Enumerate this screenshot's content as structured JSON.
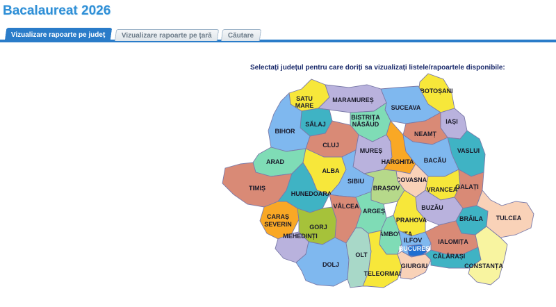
{
  "page": {
    "title": "Bacalaureat 2026"
  },
  "tabs": [
    {
      "label": "Vizualizare rapoarte pe județ",
      "active": true
    },
    {
      "label": "Vizualizare rapoarte pe țară",
      "active": false
    },
    {
      "label": "Căutare",
      "active": false
    }
  ],
  "map": {
    "instruction": "Selectați județul pentru care doriți sa vizualizați listele/rapoartele disponibile:",
    "counties": {
      "satu_mare": {
        "line1": "SATU",
        "line2": "MARE",
        "color": "#f7e73a"
      },
      "maramures": {
        "label": "MARAMUREȘ",
        "color": "#b9b2dd"
      },
      "botosani": {
        "label": "BOTOȘANI",
        "color": "#f7e73a"
      },
      "suceava": {
        "label": "SUCEAVA",
        "color": "#7fb8ef"
      },
      "bistrita": {
        "line1": "BISTRIȚA",
        "line2": "NĂSĂUD",
        "color": "#7fdcb6"
      },
      "salaj": {
        "label": "SĂLAJ",
        "color": "#3fb3c4"
      },
      "bihor": {
        "label": "BIHOR",
        "color": "#7fb8ef"
      },
      "iasi": {
        "label": "IAȘI",
        "color": "#b9b2dd"
      },
      "neamt": {
        "label": "NEAMȚ",
        "color": "#d98a76"
      },
      "cluj": {
        "label": "CLUJ",
        "color": "#d98a76"
      },
      "mures": {
        "label": "MUREȘ",
        "color": "#b9b2dd"
      },
      "harghita": {
        "label": "HARGHITA",
        "color": "#f9a825"
      },
      "vaslui": {
        "label": "VASLUI",
        "color": "#3fb3c4"
      },
      "bacau": {
        "label": "BACĂU",
        "color": "#7fb8ef"
      },
      "arad": {
        "label": "ARAD",
        "color": "#7fdcb6"
      },
      "alba": {
        "label": "ALBA",
        "color": "#f7e73a"
      },
      "sibiu": {
        "label": "SIBIU",
        "color": "#7fb8ef"
      },
      "covasna": {
        "label": "COVASNA",
        "color": "#f9d2b8"
      },
      "vrancea": {
        "label": "VRANCEA",
        "color": "#f7e73a"
      },
      "galati": {
        "label": "GALAȚI",
        "color": "#d98a76"
      },
      "timis": {
        "label": "TIMIȘ",
        "color": "#d98a76"
      },
      "hunedoara": {
        "label": "HUNEDOARA",
        "color": "#3fb3c4"
      },
      "brasov": {
        "label": "BRAȘOV",
        "color": "#b6d98a"
      },
      "valcea": {
        "label": "VÂLCEA",
        "color": "#d98a76"
      },
      "arges": {
        "label": "ARGEȘ",
        "color": "#7fdcb6"
      },
      "buzau": {
        "label": "BUZĂU",
        "color": "#b9b2dd"
      },
      "braila": {
        "label": "BRĂILA",
        "color": "#3fb3c4"
      },
      "tulcea": {
        "label": "TULCEA",
        "color": "#f9d2b8"
      },
      "prahova": {
        "label": "PRAHOVA",
        "color": "#f7e73a"
      },
      "caras": {
        "line1": "CARAȘ",
        "line2": "SEVERIN",
        "color": "#f9a825"
      },
      "gorj": {
        "label": "GORJ",
        "color": "#a6c23a"
      },
      "mehedinti": {
        "label": "MEHEDINȚI",
        "color": "#b9b2dd"
      },
      "dambovita": {
        "label": "DÂMBOVIȚA",
        "color": "#7fdcb6"
      },
      "ilfov": {
        "label": "ILFOV",
        "color": "#7fb8ef"
      },
      "bucuresti": {
        "label": "BUCUREȘTI",
        "color": "#1f6fd1"
      },
      "ialomita": {
        "label": "IALOMIȚA",
        "color": "#d98a76"
      },
      "dolj": {
        "label": "DOLJ",
        "color": "#7fb8ef"
      },
      "olt": {
        "label": "OLT",
        "color": "#a8d8c8"
      },
      "teleorman": {
        "label": "TELEORMAN",
        "color": "#f7e73a"
      },
      "giurgiu": {
        "label": "GIURGIU",
        "color": "#f9d2b8"
      },
      "calarasi": {
        "label": "CĂLĂRAȘI",
        "color": "#3fb3c4"
      },
      "constanta": {
        "label": "CONSTANȚA",
        "color": "#f8f4a0"
      }
    }
  }
}
